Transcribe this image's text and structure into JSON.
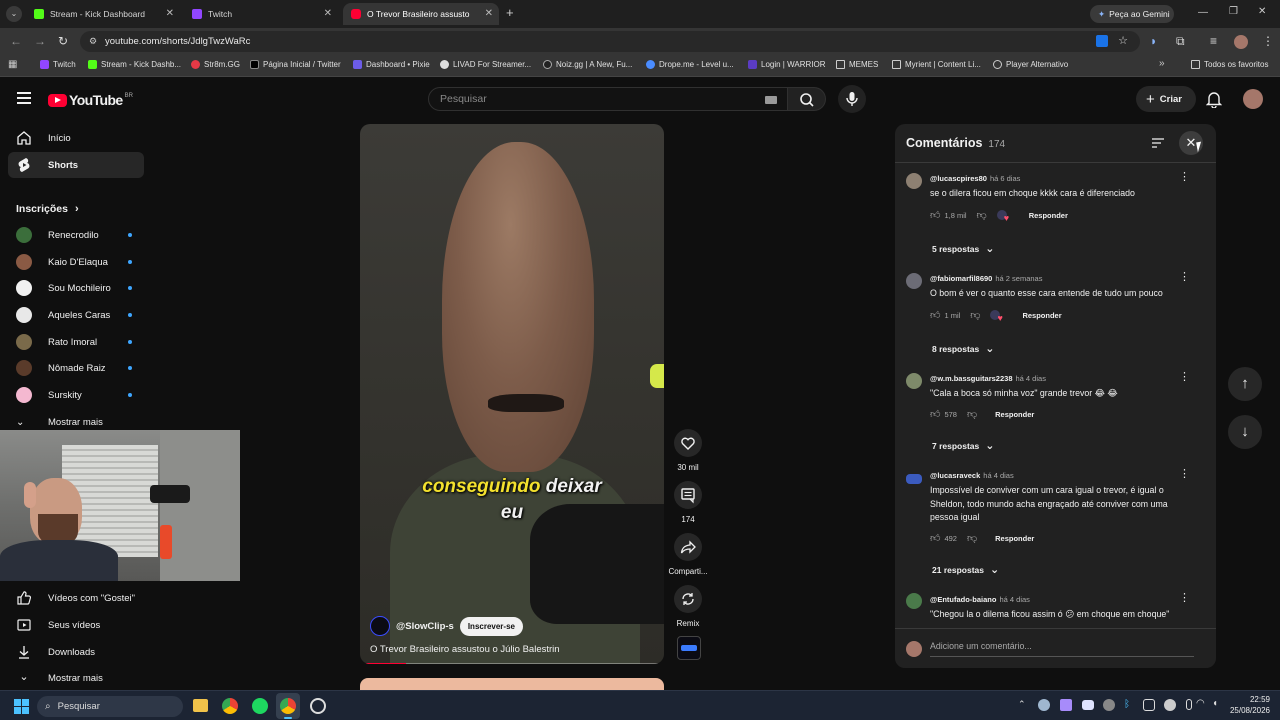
{
  "browser": {
    "tabs": [
      {
        "label": "Stream - Kick Dashboard",
        "color": "#53fc18"
      },
      {
        "label": "Twitch",
        "color": "#9146ff"
      },
      {
        "label": "O Trevor Brasileiro assusto",
        "color": "#ff0033"
      }
    ],
    "gemini_label": "Peça ao Gemini",
    "url": "youtube.com/shorts/JdlgTwzWaRc",
    "bookmarks": [
      "Twitch",
      "Stream - Kick Dashb...",
      "Str8m.GG",
      "Página Inicial / Twitter",
      "Dashboard • Pixie",
      "LIVAD For Streamer...",
      "Noiz.gg | A New, Fu...",
      "Drope.me - Level u...",
      "Login | WARRIOR",
      "MEMES",
      "Myrient | Content Li...",
      "Player Alternativo"
    ],
    "bookmarks_all": "Todos os favoritos"
  },
  "youtube": {
    "logo_text": "YouTube",
    "logo_region": "BR",
    "search_placeholder": "Pesquisar",
    "create_label": "Criar",
    "sidebar": {
      "home": "Início",
      "shorts": "Shorts",
      "subscriptions_title": "Inscrições",
      "subscriptions": [
        {
          "name": "Renecrodilo",
          "color": "#3b6e3b"
        },
        {
          "name": "Kaio D'Elaqua",
          "color": "#8a5a44"
        },
        {
          "name": "Sou Mochileiro",
          "color": "#f1f1f1"
        },
        {
          "name": "Aqueles Caras",
          "color": "#e8e8e8"
        },
        {
          "name": "Rato Imoral",
          "color": "#7a6a4a"
        },
        {
          "name": "Nômade Raiz",
          "color": "#5a3b2a"
        },
        {
          "name": "Surskity",
          "color": "#f4b8d0"
        }
      ],
      "show_more": "Mostrar mais",
      "liked": "Vídeos com \"Gostei\"",
      "your_videos": "Seus vídeos",
      "downloads": "Downloads",
      "show_more_2": "Mostrar mais"
    },
    "short": {
      "caption_line1_highlight": "conseguindo",
      "caption_line1_rest": " deixar",
      "caption_line2": "eu",
      "channel": "@SlowClip-s",
      "subscribe": "Inscrever-se",
      "title": "O Trevor Brasileiro assustou o Júlio Balestrin",
      "likes": "30 mil",
      "comments_count": "174",
      "share": "Comparti...",
      "remix": "Remix"
    },
    "comments": {
      "title": "Comentários",
      "count": "174",
      "reply_label": "Responder",
      "add_placeholder": "Adicione um comentário...",
      "items": [
        {
          "author": "@lucascpires80",
          "ago": "há 6 dias",
          "text": "se o dilera ficou em choque kkkk cara é diferenciado",
          "likes": "1,8 mil",
          "replies": "5 respostas",
          "creator_heart": true
        },
        {
          "author": "@fabiomarfil8690",
          "ago": "há 2 semanas",
          "text": "O bom é ver o quanto esse cara entende de tudo um pouco",
          "likes": "1 mil",
          "replies": "8 respostas",
          "creator_heart": true
        },
        {
          "author": "@w.m.bassguitars2238",
          "ago": "há 4 dias",
          "text": "\"Cala a boca só minha voz\" grande trevor 😂 😂",
          "likes": "578",
          "replies": "7 respostas",
          "creator_heart": false
        },
        {
          "author": "@lucasraveck",
          "ago": "há 4 dias",
          "text": "Impossível de conviver com um cara igual o trevor, é igual o Sheldon, todo mundo acha engraçado até conviver com uma pessoa igual",
          "likes": "492",
          "replies": "21 respostas",
          "creator_heart": false
        },
        {
          "author": "@Entufado-baiano",
          "ago": "há 4 dias",
          "text": "\"Chegou la o dilema ficou assim ó 😕 em choque em choque\"",
          "likes": "",
          "replies": "",
          "creator_heart": false
        }
      ]
    }
  },
  "taskbar": {
    "search": "Pesquisar",
    "time": "22:59",
    "date": "25/08/2026"
  }
}
